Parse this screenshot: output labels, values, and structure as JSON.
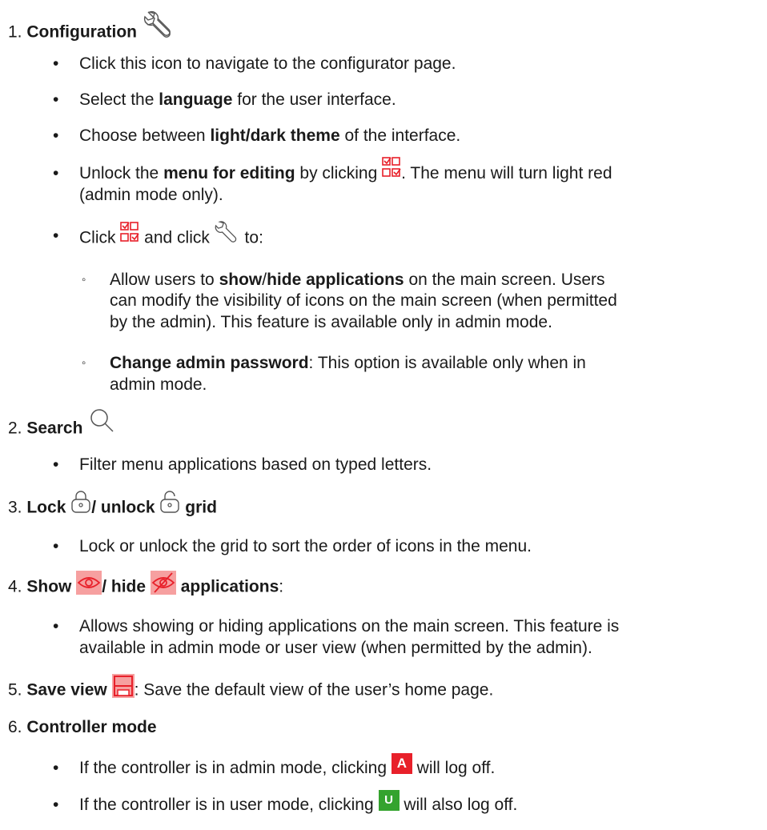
{
  "items": [
    {
      "num": "1.",
      "title": "Configuration",
      "icon": "wrench-icon",
      "bullets": [
        "Click this icon to navigate to the configurator page.",
        {
          "a": "Select the ",
          "b": "language",
          "c": " for the user interface."
        },
        {
          "a": "Choose between ",
          "b": "light/dark theme",
          "c": " of the interface."
        },
        {
          "a": "Unlock the ",
          "b": "menu for editing",
          "c": " by clicking ",
          "d": ". The menu will turn light red",
          "e": "(admin mode only)."
        },
        {
          "a": "Click ",
          "b": " and click ",
          "c": " to:"
        }
      ],
      "sub": [
        {
          "a": "Allow users to ",
          "b": "show",
          "c": "/",
          "d": "hide applications",
          "e": " on the main screen. Users",
          "l2": "can modify the visibility of icons on the main screen (when permitted",
          "l3": "by the admin). This feature is available only in admin mode."
        },
        {
          "b": "Change admin password",
          "a": ": This option is available only when in",
          "l2": "admin mode."
        }
      ]
    },
    {
      "num": "2.",
      "title": "Search",
      "icon": "search-icon",
      "bullets": [
        "Filter menu applications based on typed letters."
      ]
    },
    {
      "num": "3.",
      "title_a": "Lock",
      "sep": "/ ",
      "title_b": "unlock",
      "title_c": "grid",
      "bullets": [
        "Lock or unlock the grid to sort the order of icons in the menu."
      ]
    },
    {
      "num": "4.",
      "title_a": "Show",
      "sep": "/ ",
      "title_b": "hide",
      "title_c": "applications",
      "colon": ":",
      "bullets": [
        {
          "l1": "Allows showing or hiding applications on the main screen. This feature is",
          "l2": "available in admin mode or user view (when permitted by the admin)."
        }
      ]
    },
    {
      "num": "5.",
      "title": "Save view",
      "rest": ": Save the default view of the user’s home page."
    },
    {
      "num": "6.",
      "title": "Controller mode",
      "bullets": [
        {
          "a": "If the controller is in admin mode, clicking ",
          "badge": "A",
          "b": " will log off."
        },
        {
          "a": "If the controller is in user mode, clicking ",
          "badge": "U",
          "b": " will also log off."
        }
      ]
    }
  ],
  "colors": {
    "red": "#e8202a",
    "green": "#34a32e",
    "pink": "#f08c8c"
  }
}
